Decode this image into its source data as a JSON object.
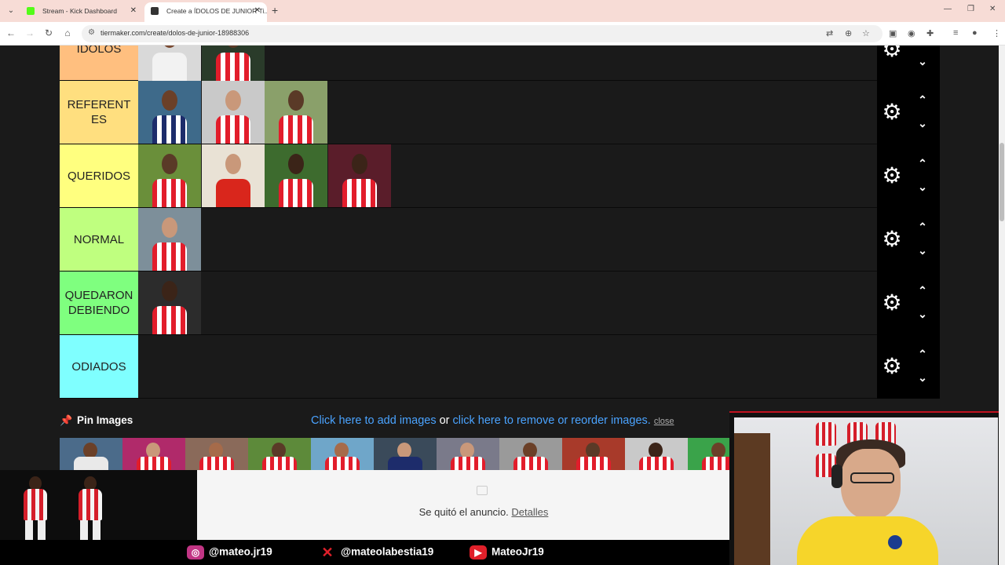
{
  "browser": {
    "tabs": [
      {
        "title": "Stream - Kick Dashboard",
        "favicon_color": "#53fc18"
      },
      {
        "title": "Create a ÍDOLOS DE JUNIOR Ti...",
        "favicon_color": "#333333"
      }
    ],
    "url": "tiermaker.com/create/dolos-de-junior-18988306"
  },
  "tiers": [
    {
      "label": "ÍDOLOS",
      "color": "#ffbf7f",
      "items": 2
    },
    {
      "label": "REFERENTES",
      "color": "#ffdf7f",
      "items": 3
    },
    {
      "label": "QUERIDOS",
      "color": "#ffff7f",
      "items": 4
    },
    {
      "label": "NORMAL",
      "color": "#bfff7f",
      "items": 1
    },
    {
      "label": "QUEDARON DEBIENDO",
      "color": "#7fff7f",
      "items": 1
    },
    {
      "label": "ODIADOS",
      "color": "#7fffff",
      "items": 0
    }
  ],
  "pin": {
    "title": "Pin Images",
    "link_add": "Click here to add images",
    "or": "or",
    "link_remove": "click here to remove or reorder images.",
    "close": "close"
  },
  "ad": {
    "text": "Se quitó el anuncio.",
    "details": "Detalles"
  },
  "social": {
    "instagram": "@mateo.jr19",
    "x": "@mateolabestia19",
    "youtube": "MateoJr19"
  }
}
